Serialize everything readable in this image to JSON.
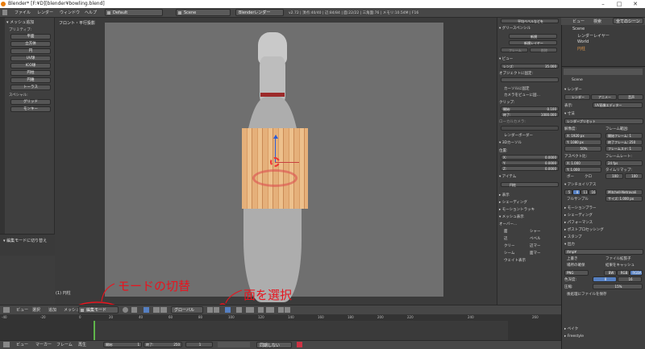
{
  "title": "Blender* [F:¥D][blender¥bowling.blend]",
  "menu": {
    "items": [
      "ファイル",
      "レンダー",
      "ウィンドウ",
      "ヘルプ"
    ],
    "layout": "Default",
    "scene": "Scene",
    "engine": "Blenderレンダー",
    "stats": "v2.72 | 頂点:40/40 | 辺:84/84 | 面:22/22 | 三角面:76 | メモリ:10.54M | F16"
  },
  "toolshelf": {
    "header": "▾ メッシュ追加",
    "prim_label": "プリミティブ:",
    "prims": [
      "平面",
      "立方体",
      "円",
      "UV球",
      "ICO球",
      "円柱",
      "円錐",
      "トーラス"
    ],
    "special_label": "スペシャル:",
    "specials": [
      "グリッド",
      "モンキー"
    ]
  },
  "operator_panel": "▾ 編集モードに切り替え",
  "viewport": {
    "label": "フロント・平行投影",
    "object_label": "(1) 円柱"
  },
  "vpheader": {
    "items": [
      "ビュー",
      "選択",
      "追加",
      "メッシュ"
    ],
    "mode": "編集モード",
    "orientation": "グローバル"
  },
  "annotations": {
    "mode": "モードの切替",
    "face": "面を選択"
  },
  "nprops": {
    "top_btn": "平均ベベルなどを",
    "gp": "▾ グリースペンシル",
    "gp_new": "新規",
    "gp_newlayer": "新規レイヤー",
    "gp_frame": "フレーム",
    "gp_del": "削除",
    "view": "▾ ビュー",
    "lens": "レンズ:",
    "lens_val": "35.000",
    "lock_obj": "オブジェクトに固定:",
    "lock_cursor": "カーソルに固定",
    "cam_to_view": "カメラをビューに固…",
    "clip": "クリップ:",
    "clip_start": "開始:",
    "clip_start_val": "0.100",
    "clip_end": "終了:",
    "clip_end_val": "1000.000",
    "local_cam": "ローカルカメラ:",
    "render_border": "レンダーボーダー",
    "cursor3d": "▾ 3Dカーソル",
    "location": "位置:",
    "x": "X:",
    "y": "Y:",
    "z": "Z:",
    "zero": "0.0000",
    "item": "▾ アイテム",
    "item_name": "円柱",
    "display": "▸ 表示",
    "shading": "▸ シェーディング",
    "motion": "▸ モーショントラッキ",
    "mesh_disp": "▾ メッシュ表示",
    "overlay": "オーバー...",
    "ov1": "面",
    "ov2": "シャー",
    "ov3": "辺",
    "ov4": "ベベル",
    "ov5": "クリー",
    "ov6": "辺マー",
    "ov7": "シーム",
    "ov8": "面マー",
    "weight": "ウェイト表示"
  },
  "outliner": {
    "header": [
      "ビュー",
      "検索",
      "全てのシーン"
    ],
    "items": [
      "Scene",
      "レンダーレイヤー",
      "World",
      "円柱"
    ]
  },
  "render": {
    "scene": "Scene",
    "render_hdr": "▾ レンダー",
    "btn_render": "レンダー",
    "btn_anim": "アニメー",
    "btn_audio": "音声",
    "display": "表示:",
    "display_val": "UV画像エディター",
    "dimensions": "▾ 寸法",
    "preset": "レンダープリセット",
    "resolution": "解像度:",
    "resx": "X: 1920 px",
    "resy": "Y: 1080 px",
    "pct": "50%",
    "frange": "フレーム範囲:",
    "fstart": "開始フレーム: 1",
    "fend": "終了フレーム: 250",
    "fstep": "フレームステ: 1",
    "aspect": "アスペクト比:",
    "ax": "X: 1.000",
    "ay": "Y: 1.000",
    "framerate": "フレームレート:",
    "fps": "24 fps",
    "timemap": "タイムリマップ:",
    "tm_old": "100",
    "tm_new": "100",
    "border": "ボー",
    "crop": "クロ",
    "aa": "▾ アンチエイリアス",
    "aa_vals": [
      "5",
      "8",
      "11",
      "16"
    ],
    "aa_filter": "Mitchell-Netravali",
    "full": "フルサンプル",
    "size": "サイズ: 1.000 px",
    "sampled": "▸ モーションブラー",
    "shading": "▸ シェーディング",
    "perf": "▸ パフォーマンス",
    "post": "▸ ポストプロセッシング",
    "stamp": "▸ スタンプ",
    "output": "▾ 出力",
    "path": "/tmp¥",
    "overwrite": "上書き",
    "ext": "ファイル拡張子",
    "placeholder": "場所の確保",
    "cache": "結果をキャッシュ",
    "fmt": "PNG",
    "bw": "BW",
    "rgb": "RGB",
    "rgba": "RGBA",
    "depth": "色深度:",
    "d8": "8",
    "d16": "16",
    "compress": "圧縮:",
    "comp_val": "15%",
    "save_file": "後処理にファイルを保存",
    "bake": "▸ ベイク",
    "freestyle": "▸ Freestyle"
  },
  "timeline": {
    "ticks": [
      "-40",
      "-20",
      "0",
      "20",
      "40",
      "60",
      "80",
      "100",
      "120",
      "140",
      "160",
      "180",
      "200",
      "220",
      "240",
      "260"
    ],
    "items": [
      "ビュー",
      "マーカー",
      "フレーム",
      "再生"
    ],
    "start": "開始:",
    "start_val": "1",
    "end": "終了:",
    "end_val": "250",
    "cur": "1",
    "sync": "同期しない"
  }
}
